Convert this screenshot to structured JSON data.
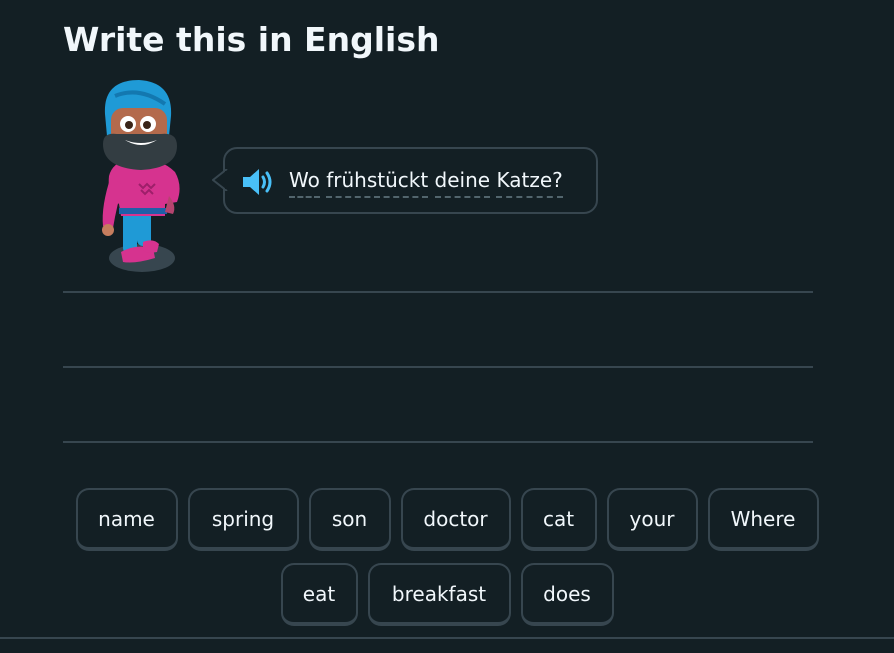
{
  "header": {
    "title": "Write this in English"
  },
  "prompt": {
    "speaker_icon": "speaker-icon",
    "words": [
      "Wo",
      "frühstückt",
      "deine",
      "Katze?"
    ]
  },
  "word_bank": {
    "row1": [
      "name",
      "spring",
      "son",
      "doctor",
      "cat",
      "your",
      "Where"
    ],
    "row2": [
      "eat",
      "breakfast",
      "does"
    ]
  },
  "colors": {
    "background": "#131f24",
    "border": "#37464f",
    "text": "#f1f7fb",
    "speaker": "#49c0f8"
  }
}
